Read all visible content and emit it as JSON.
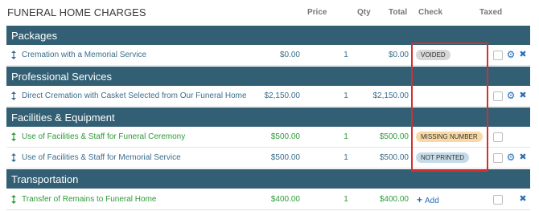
{
  "title": "FUNERAL HOME CHARGES",
  "columns": {
    "price": "Price",
    "qty": "Qty",
    "total": "Total",
    "check": "Check",
    "taxed": "Taxed"
  },
  "sections": [
    {
      "title": "Packages"
    },
    {
      "title": "Professional Services"
    },
    {
      "title": "Facilities & Equipment"
    },
    {
      "title": "Transportation"
    }
  ],
  "items": [
    {
      "name": "Cremation with a Memorial Service",
      "price": "$0.00",
      "qty": "1",
      "total": "$0.00",
      "check": "VOIDED",
      "taxed": false,
      "status_color": "#b5b5b5"
    },
    {
      "name": "Direct Cremation with Casket Selected from Our Funeral Home",
      "price": "$2,150.00",
      "qty": "1",
      "total": "$2,150.00",
      "check": "",
      "taxed": false
    },
    {
      "name": "Use of Facilities & Staff for Funeral Ceremony",
      "price": "$500.00",
      "qty": "1",
      "total": "$500.00",
      "check": "MISSING NUMBER",
      "taxed": false,
      "status_color": "#f8d8a4"
    },
    {
      "name": "Use of Facilities & Staff for Memorial Service",
      "price": "$500.00",
      "qty": "1",
      "total": "$500.00",
      "check": "NOT PRINTED",
      "taxed": false,
      "status_color": "#c6dbe8"
    },
    {
      "name": "Transfer of Remains to Funeral Home",
      "price": "$400.00",
      "qty": "1",
      "total": "$400.00",
      "check_action": "Add",
      "taxed": false
    }
  ],
  "colors": {
    "section_bar": "#325f74",
    "link_blue": "#3b6d8c",
    "green_text": "#2e9a38",
    "highlight": "#d32f2f"
  },
  "icons": {
    "drag": "drag-handle-icon",
    "settings": "gear-icon",
    "remove": "close-icon",
    "add": "plus-icon"
  }
}
